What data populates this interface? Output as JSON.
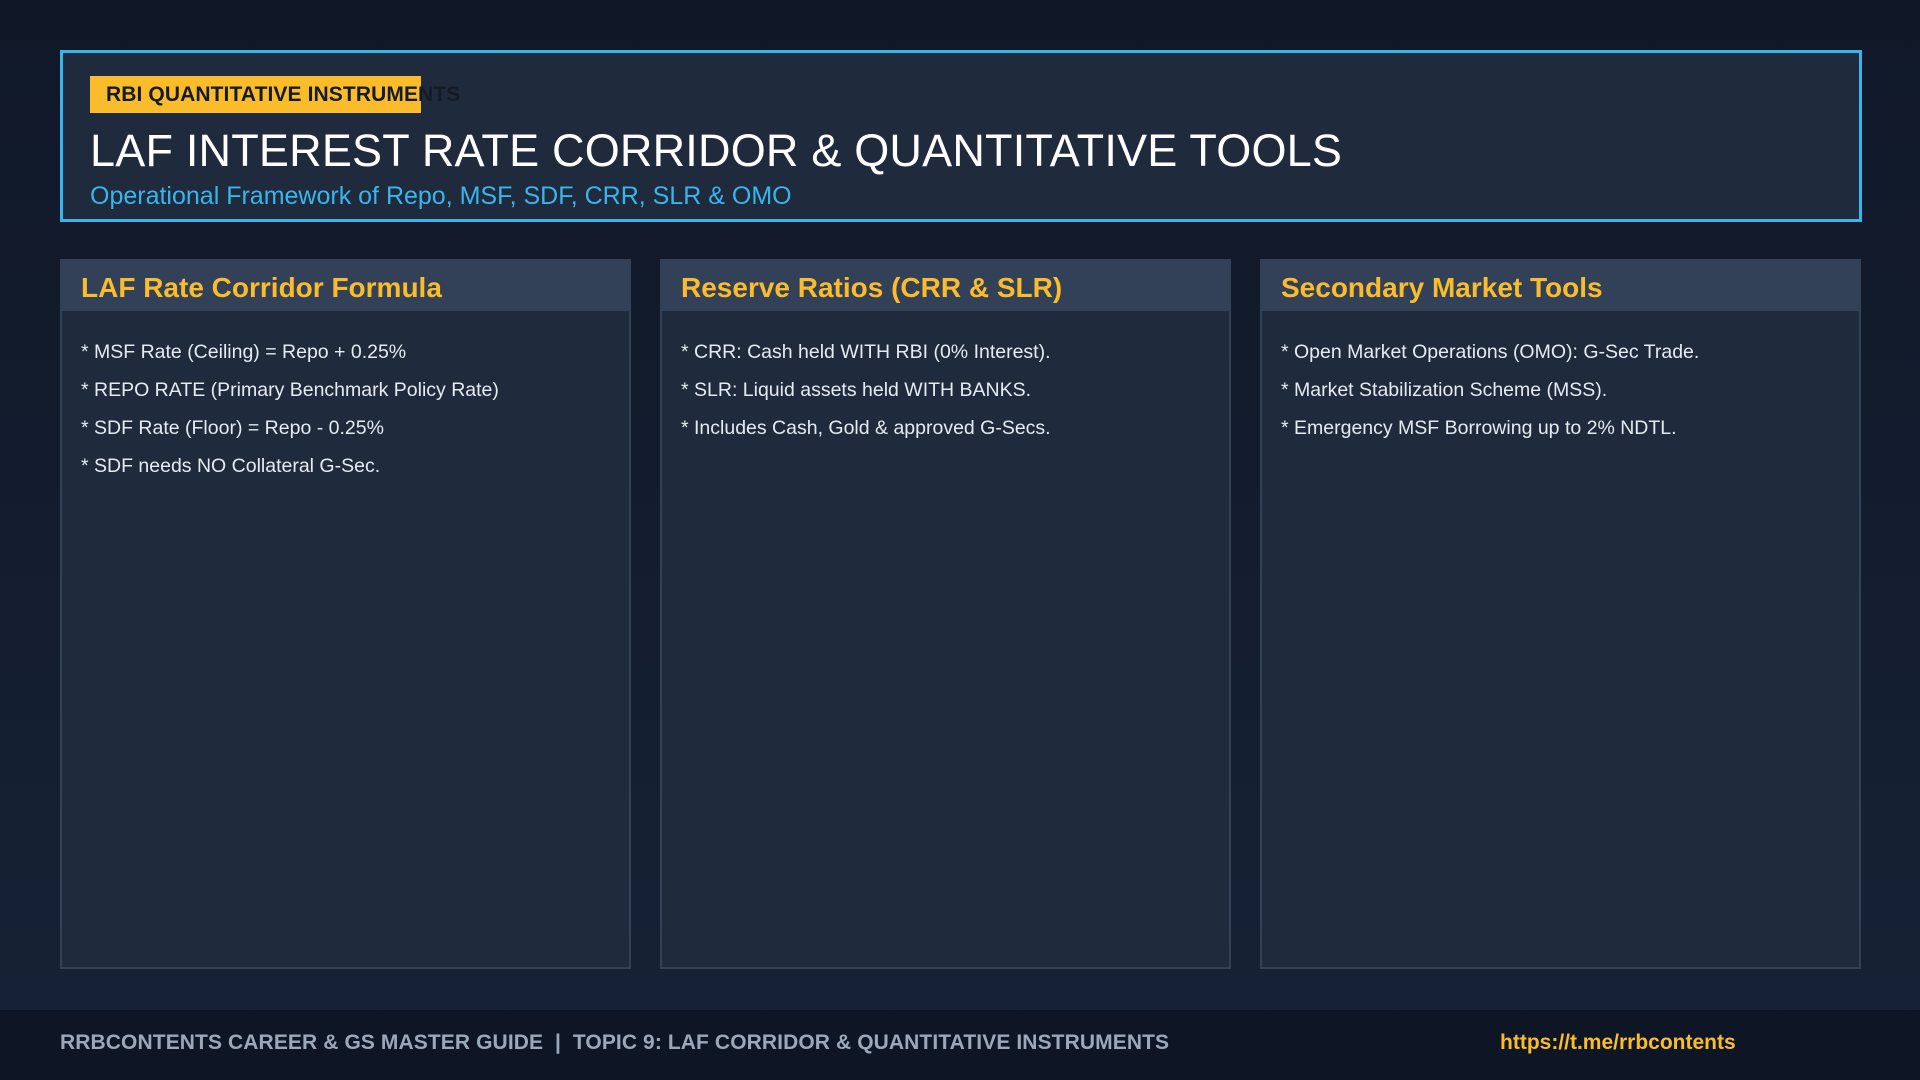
{
  "header": {
    "badge": "RBI QUANTITATIVE INSTRUMENTS",
    "title": "LAF INTEREST RATE CORRIDOR & QUANTITATIVE TOOLS",
    "subtitle": "Operational Framework of Repo, MSF, SDF, CRR, SLR & OMO"
  },
  "cards": [
    {
      "title": "LAF Rate Corridor Formula",
      "items": [
        "* MSF Rate (Ceiling) = Repo + 0.25%",
        "* REPO RATE (Primary Benchmark Policy Rate)",
        "* SDF Rate (Floor) = Repo - 0.25%",
        "* SDF needs NO Collateral G-Sec."
      ]
    },
    {
      "title": "Reserve Ratios (CRR & SLR)",
      "items": [
        "* CRR: Cash held WITH RBI (0% Interest).",
        "* SLR: Liquid assets held WITH BANKS.",
        "* Includes Cash, Gold & approved G-Secs."
      ]
    },
    {
      "title": "Secondary Market Tools",
      "items": [
        "* Open Market Operations (OMO): G-Sec Trade.",
        "* Market Stabilization Scheme (MSS).",
        "* Emergency MSF Borrowing up to 2% NDTL."
      ]
    }
  ],
  "footer": {
    "guide": "RRBCONTENTS CAREER & GS MASTER GUIDE  |  TOPIC 9: LAF CORRIDOR & QUANTITATIVE INSTRUMENTS",
    "link": "https://t.me/rrbcontents"
  },
  "colors": {
    "accent_blue": "#38b6ec",
    "accent_yellow": "#fbbc2c",
    "panel": "#1f2a3d",
    "panel_header": "#324157",
    "background": "#101828"
  }
}
